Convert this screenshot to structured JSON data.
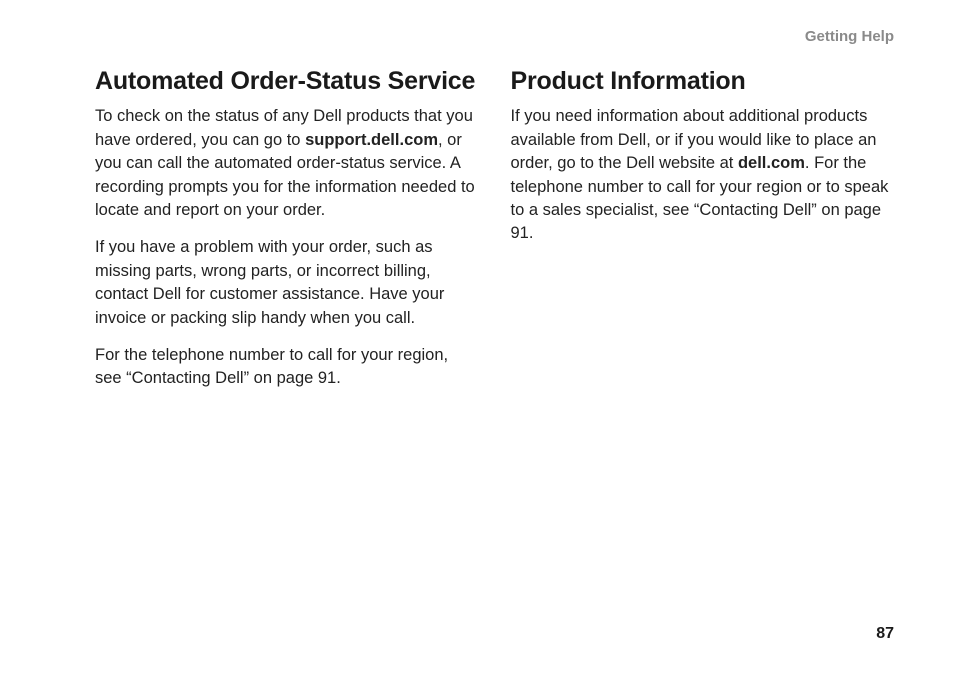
{
  "header": {
    "section_label": "Getting Help"
  },
  "page_number": "87",
  "left_column": {
    "heading": "Automated Order-Status Service",
    "p1_before": "To check on the status of any Dell products that you have ordered, you can go to ",
    "p1_bold": "support.dell.com",
    "p1_after": ", or you can call the automated order-status service. A recording prompts you for the information needed to locate and report on your order.",
    "p2": "If you have a problem with your order, such as missing parts, wrong parts, or incorrect billing, contact Dell for customer assistance. Have your invoice or packing slip handy when you call.",
    "p3": "For the telephone number to call for your region, see “Contacting Dell” on page 91."
  },
  "right_column": {
    "heading": "Product Information",
    "p1_before": "If you need information about additional products available from Dell, or if you would like to place an order, go to the Dell website at ",
    "p1_bold": "dell.com",
    "p1_after": ". For the telephone number to call for your region or to speak to a sales specialist, see “Contacting Dell” on page 91."
  }
}
